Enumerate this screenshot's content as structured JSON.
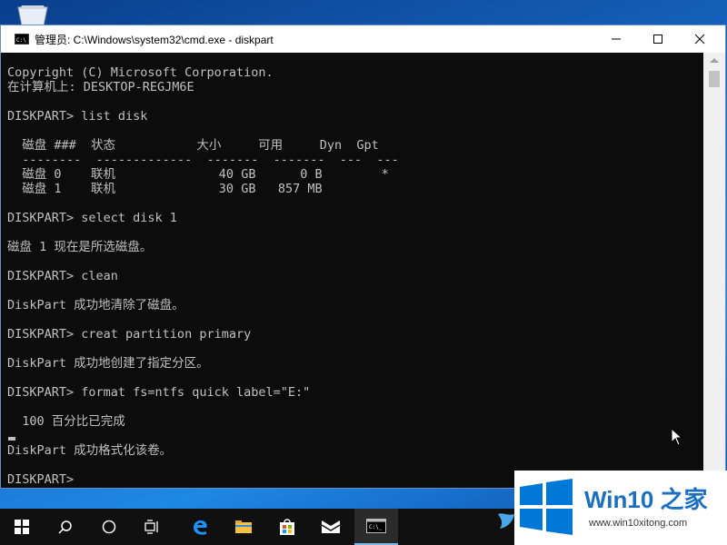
{
  "window": {
    "title": "管理员: C:\\Windows\\system32\\cmd.exe - diskpart",
    "minimize": "minimize",
    "maximize": "maximize",
    "close": "close"
  },
  "console": {
    "lines": [
      {
        "text": "Copyright (C) Microsoft Corporation.",
        "row": 0
      },
      {
        "text": "在计算机上: DESKTOP-REGJM6E",
        "row": 1
      },
      {
        "text": "DISKPART> list disk",
        "row": 3
      },
      {
        "text": "  磁盘 ###  状态           大小     可用     Dyn  Gpt",
        "row": 5
      },
      {
        "text": "  --------  -------------  -------  -------  ---  ---",
        "row": 6
      },
      {
        "text": "  磁盘 0    联机              40 GB      0 B        *",
        "row": 7
      },
      {
        "text": "  磁盘 1    联机              30 GB   857 MB",
        "row": 8
      },
      {
        "text": "DISKPART> select disk 1",
        "row": 10
      },
      {
        "text": "磁盘 1 现在是所选磁盘。",
        "row": 12
      },
      {
        "text": "DISKPART> clean",
        "row": 14
      },
      {
        "text": "DiskPart 成功地清除了磁盘。",
        "row": 16
      },
      {
        "text": "DISKPART> creat partition primary",
        "row": 18
      },
      {
        "text": "DiskPart 成功地创建了指定分区。",
        "row": 20
      },
      {
        "text": "DISKPART> format fs=ntfs quick label=\"E:\"",
        "row": 22
      },
      {
        "text": "  100 百分比已完成",
        "row": 24
      },
      {
        "text": "DiskPart 成功格式化该卷。",
        "row": 26
      },
      {
        "text": "DISKPART> ",
        "row": 28
      }
    ]
  },
  "taskbar": {
    "items": [
      "start-icon",
      "search-icon",
      "cortana-icon",
      "task-view-icon",
      "edge-icon",
      "file-explorer-icon",
      "store-icon",
      "mail-icon",
      "cmd-icon"
    ]
  },
  "watermark": {
    "brand": "Win10 之家",
    "url": "www.win10xitong.com"
  },
  "colors": {
    "console_bg": "#0c0c0c",
    "console_fg": "#c0c0c0",
    "taskbar_bg": "#101010",
    "brand_blue": "#1a6fc2"
  }
}
